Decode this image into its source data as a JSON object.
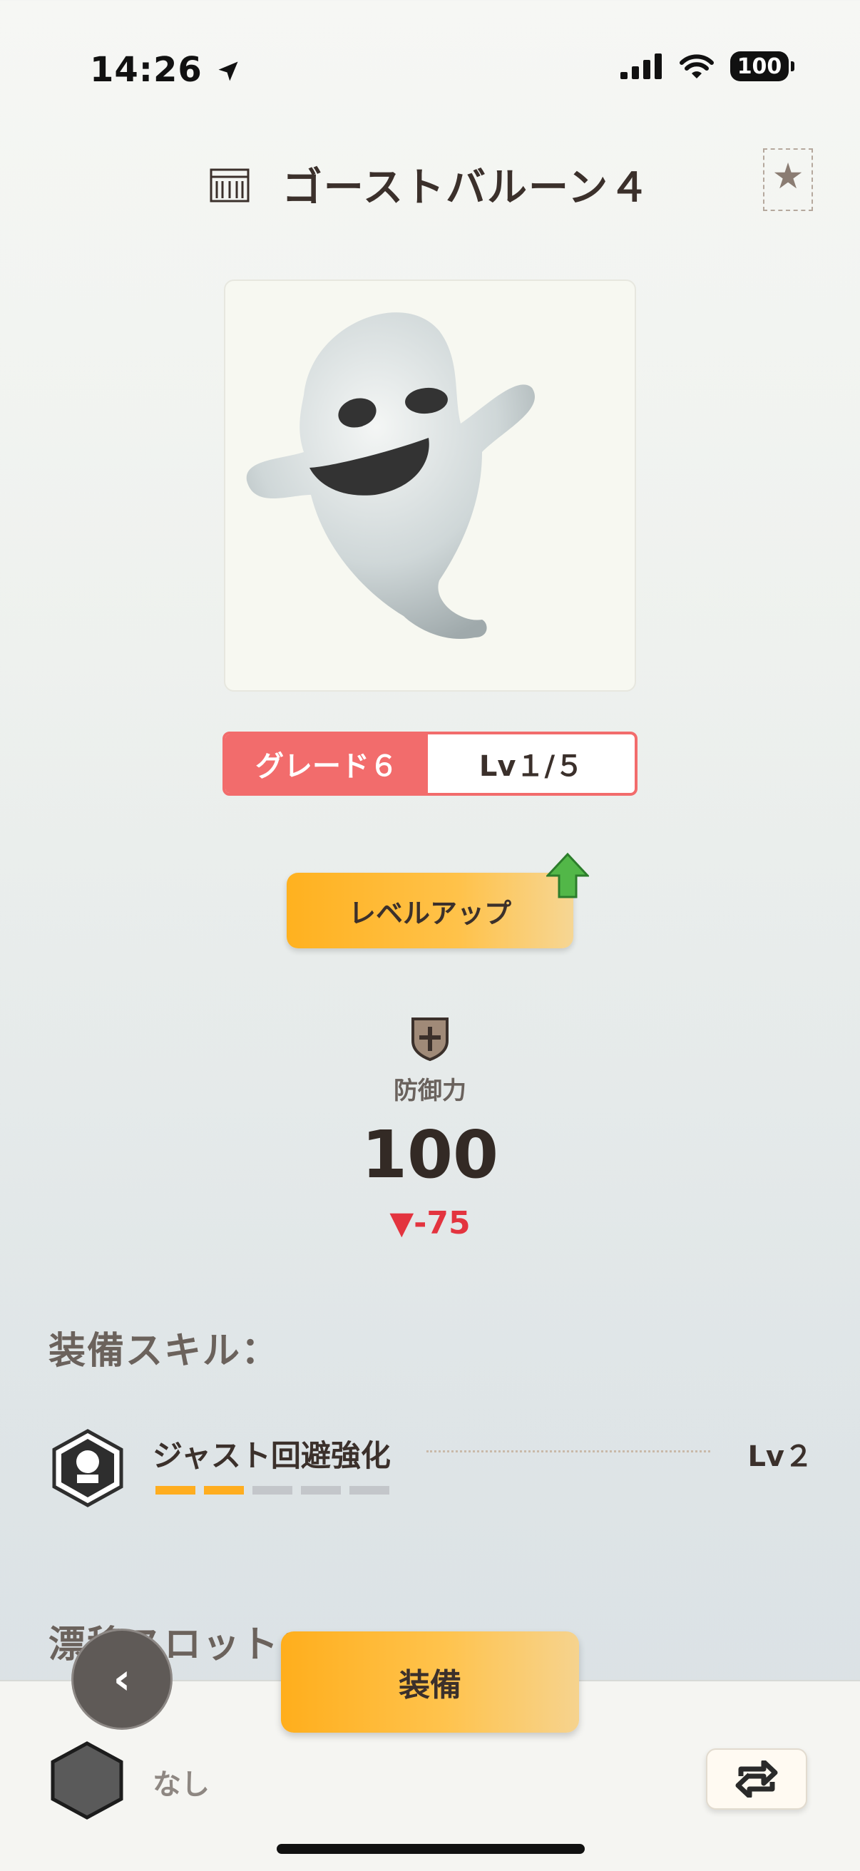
{
  "status_bar": {
    "time": "14:26",
    "battery": "100"
  },
  "header": {
    "title": "ゴーストバルーン４"
  },
  "item": {
    "grade_label": "グレード６",
    "level_label": "Lv１/５"
  },
  "level_up_button": "レベルアップ",
  "stat": {
    "label": "防御力",
    "value": "100",
    "diff": "▼-75"
  },
  "skills": {
    "section_title": "装備スキル：",
    "items": [
      {
        "name": "ジャスト回避強化",
        "level": "Lv２",
        "filled": 2,
        "total": 5
      }
    ]
  },
  "drift_slot": {
    "section_title": "漂移スロット：",
    "value": "なし"
  },
  "bottom_bar": {
    "back": "‹",
    "equip": "装備"
  },
  "colors": {
    "accent_orange": "#ffae1c",
    "grade_red": "#f26c6c",
    "diff_red": "#e3343f"
  },
  "icons": [
    "location-arrow-icon",
    "signal-icon",
    "wifi-icon",
    "battery-icon",
    "building-icon",
    "star-bookmark-icon",
    "ghost-image",
    "up-arrow-icon",
    "shield-icon",
    "skill-hex-icon",
    "empty-hex-icon",
    "swap-icon"
  ]
}
